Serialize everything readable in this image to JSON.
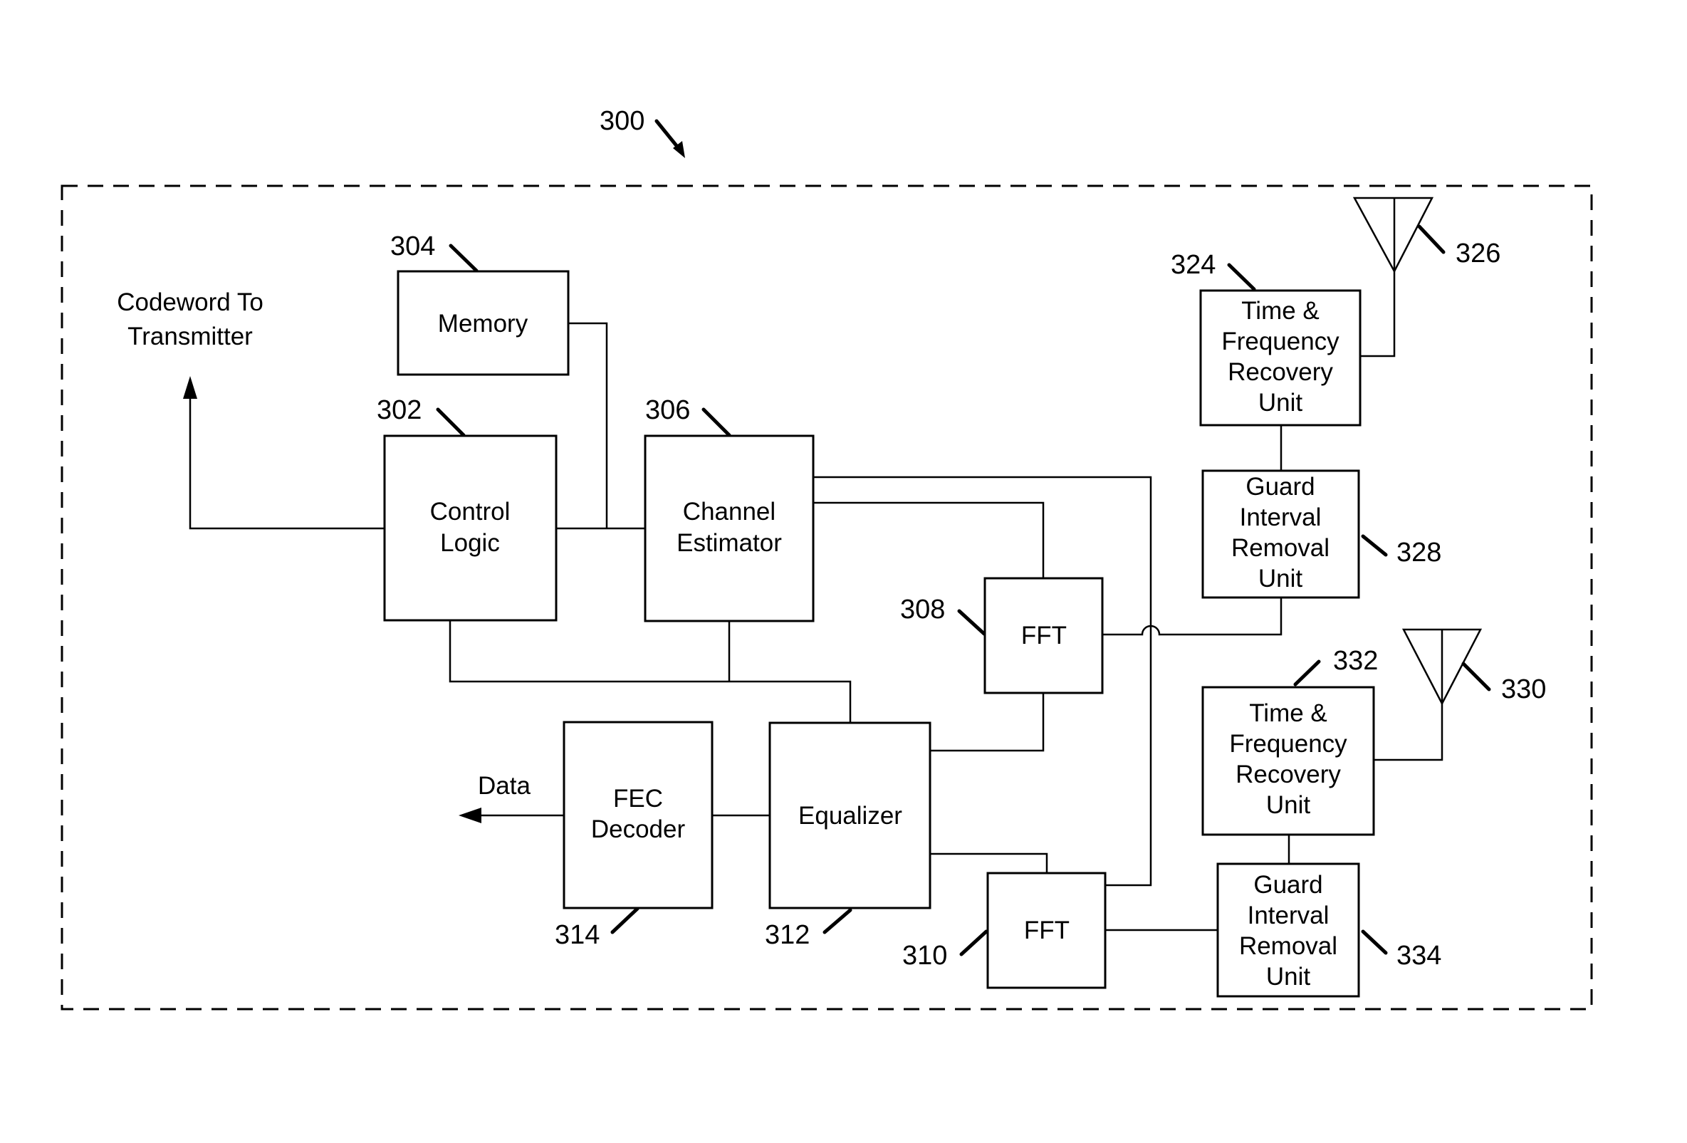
{
  "figure": {
    "ref": "300",
    "outputs": {
      "codeword_line1": "Codeword To",
      "codeword_line2": "Transmitter",
      "data": "Data"
    },
    "blocks": {
      "memory": {
        "ref": "304",
        "lines": [
          "Memory"
        ]
      },
      "control_logic": {
        "ref": "302",
        "lines": [
          "Control",
          "Logic"
        ]
      },
      "channel_estimator": {
        "ref": "306",
        "lines": [
          "Channel",
          "Estimator"
        ]
      },
      "fft_a": {
        "ref": "308",
        "lines": [
          "FFT"
        ]
      },
      "fft_b": {
        "ref": "310",
        "lines": [
          "FFT"
        ]
      },
      "equalizer": {
        "ref": "312",
        "lines": [
          "Equalizer"
        ]
      },
      "fec_decoder": {
        "ref": "314",
        "lines": [
          "FEC",
          "Decoder"
        ]
      },
      "tfr_a": {
        "ref": "324",
        "lines": [
          "Time &",
          "Frequency",
          "Recovery",
          "Unit"
        ]
      },
      "gir_a": {
        "ref": "328",
        "lines": [
          "Guard",
          "Interval",
          "Removal",
          "Unit"
        ]
      },
      "tfr_b": {
        "ref": "332",
        "lines": [
          "Time &",
          "Frequency",
          "Recovery",
          "Unit"
        ]
      },
      "gir_b": {
        "ref": "334",
        "lines": [
          "Guard",
          "Interval",
          "Removal",
          "Unit"
        ]
      }
    },
    "antennas": {
      "antenna_a": {
        "ref": "326"
      },
      "antenna_b": {
        "ref": "330"
      }
    }
  }
}
